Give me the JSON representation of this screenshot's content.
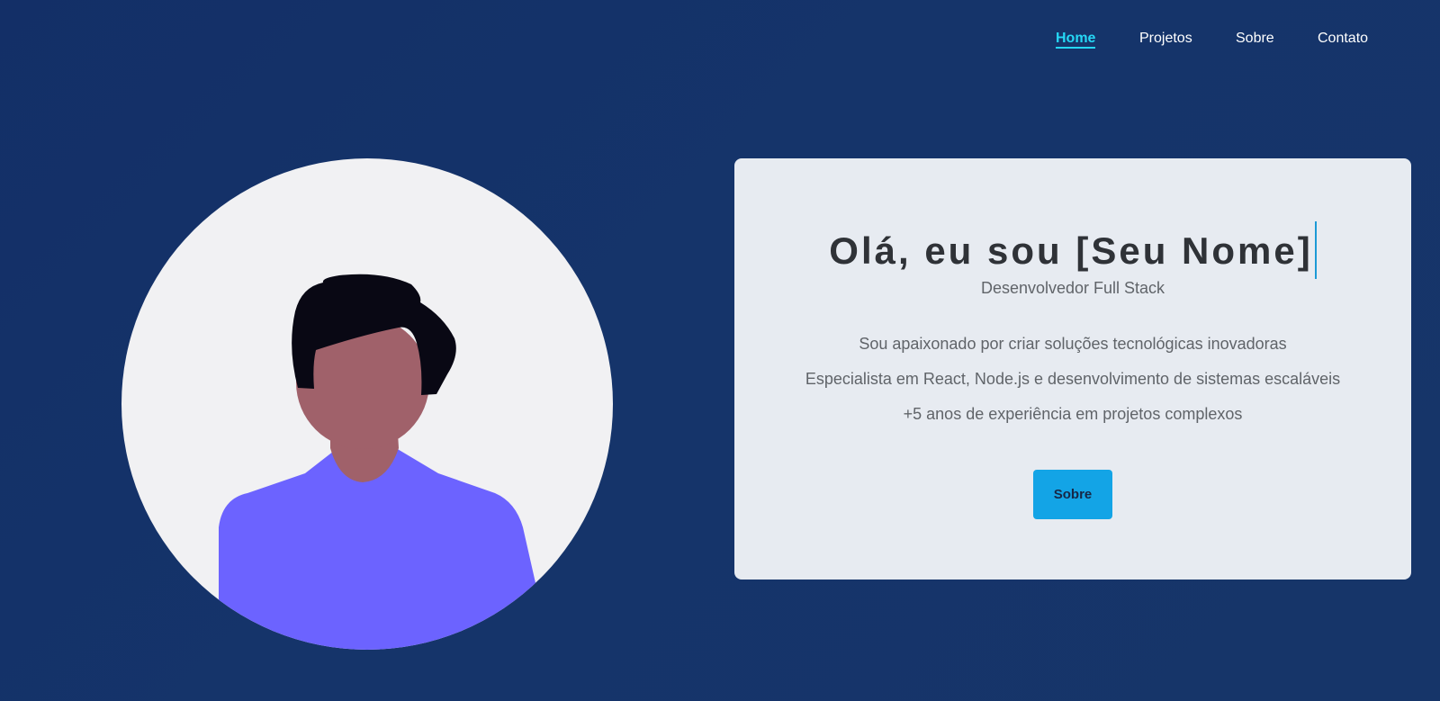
{
  "nav": {
    "items": [
      {
        "label": "Home",
        "active": true
      },
      {
        "label": "Projetos",
        "active": false
      },
      {
        "label": "Sobre",
        "active": false
      },
      {
        "label": "Contato",
        "active": false
      }
    ]
  },
  "hero": {
    "title": "Olá, eu sou [Seu Nome]",
    "subtitle": "Desenvolvedor Full Stack",
    "lines": [
      "Sou apaixonado por criar soluções tecnológicas inovadoras",
      "Especialista em React, Node.js e desenvolvimento de sistemas escaláveis",
      "+5 anos de experiência em projetos complexos"
    ],
    "button_label": "Sobre"
  },
  "colors": {
    "background": "#14326a",
    "accent": "#25d7f5",
    "button": "#13a4e6",
    "card": "#e7ebf1",
    "avatar_shirt": "#6c63ff",
    "avatar_skin": "#a0616a",
    "avatar_hair": "#090814"
  },
  "avatar": {
    "icon": "person-avatar-illustration"
  }
}
